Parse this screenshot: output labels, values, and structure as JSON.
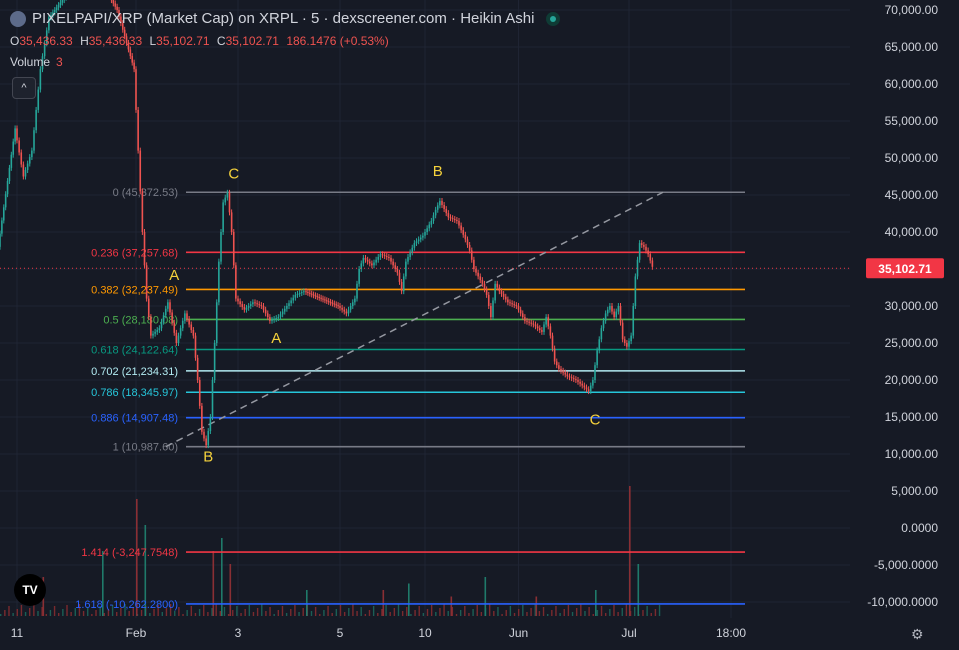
{
  "header": {
    "title": "PIXELPAPI/XRP (Market Cap) on XRPL · 5 · dexscreener.com · Heikin Ashi",
    "ohlc": [
      {
        "k": "O",
        "v": "35,436.33"
      },
      {
        "k": "H",
        "v": "35,436.33"
      },
      {
        "k": "L",
        "v": "35,102.71"
      },
      {
        "k": "C",
        "v": "35,102.71"
      },
      {
        "k": "",
        "v": "186.1476 (+0.53%)"
      }
    ],
    "volume_label": "Volume",
    "volume_value": "3",
    "collapse_icon": "chevron-up-icon",
    "tv_logo_text": "TV",
    "settings_icon": "gear-icon"
  },
  "chart_data": {
    "type": "candlestick",
    "y_axis": {
      "ticks": [
        "70,000.00",
        "65,000.00",
        "60,000.00",
        "55,000.00",
        "50,000.00",
        "45,000.00",
        "40,000.00",
        "35,000.00",
        "30,000.00",
        "25,000.00",
        "20,000.00",
        "15,000.00",
        "10,000.00",
        "5,000.00",
        "0.0000",
        "-5,000.0000",
        "-10,000.0000"
      ],
      "tick_values": [
        70000,
        65000,
        60000,
        55000,
        50000,
        45000,
        40000,
        35000,
        30000,
        25000,
        20000,
        15000,
        10000,
        5000,
        0,
        -5000,
        -10000
      ]
    },
    "x_axis": {
      "ticks": [
        "11",
        "Feb",
        "3",
        "5",
        "10",
        "Jun",
        "Jul",
        "18:00"
      ],
      "tick_positions": [
        0.02,
        0.16,
        0.28,
        0.4,
        0.5,
        0.61,
        0.74,
        0.86
      ]
    },
    "current_price": {
      "label": "35,102.71",
      "value": 35102.71,
      "color": "#f23645"
    },
    "fib_levels": [
      {
        "ratio": "0",
        "value": 45372.53,
        "label": "0 (45,372.53)",
        "color": "#787b86"
      },
      {
        "ratio": "0.236",
        "value": 37257.68,
        "label": "0.236 (37,257.68)",
        "color": "#f23645"
      },
      {
        "ratio": "0.382",
        "value": 32237.49,
        "label": "0.382 (32,237.49)",
        "color": "#ff9800"
      },
      {
        "ratio": "0.5",
        "value": 28180.08,
        "label": "0.5 (28,180.08)",
        "color": "#4caf50"
      },
      {
        "ratio": "0.618",
        "value": 24122.64,
        "label": "0.618 (24,122.64)",
        "color": "#089981"
      },
      {
        "ratio": "0.702",
        "value": 21234.31,
        "label": "0.702 (21,234.31)",
        "color": "#b2ebf2"
      },
      {
        "ratio": "0.786",
        "value": 18345.97,
        "label": "0.786 (18,345.97)",
        "color": "#26c6da"
      },
      {
        "ratio": "0.886",
        "value": 14907.48,
        "label": "0.886 (14,907.48)",
        "color": "#2962ff"
      },
      {
        "ratio": "1",
        "value": 10987.6,
        "label": "1 (10,987.60)",
        "color": "#787b86"
      },
      {
        "ratio": "1.414",
        "value": -3247.7548,
        "label": "1.414 (-3,247.7548)",
        "color": "#f23645"
      },
      {
        "ratio": "1.618",
        "value": -10262.28,
        "label": "1.618 (-10,262.2800)",
        "color": "#2962ff"
      }
    ],
    "wave_labels": [
      {
        "text": "C",
        "x": 0.275,
        "value": 47200
      },
      {
        "text": "B",
        "x": 0.245,
        "value": 9000
      },
      {
        "text": "A",
        "x": 0.205,
        "value": 33500
      },
      {
        "text": "A",
        "x": 0.325,
        "value": 25000
      },
      {
        "text": "B",
        "x": 0.515,
        "value": 47600
      },
      {
        "text": "C",
        "x": 0.7,
        "value": 14000
      }
    ],
    "price_path": [
      [
        0.0,
        38000
      ],
      [
        0.02,
        54000
      ],
      [
        0.03,
        47500
      ],
      [
        0.04,
        51000
      ],
      [
        0.05,
        62000
      ],
      [
        0.06,
        69000
      ],
      [
        0.08,
        72000
      ],
      [
        0.1,
        73000
      ],
      [
        0.12,
        74000
      ],
      [
        0.14,
        70000
      ],
      [
        0.16,
        62000
      ],
      [
        0.17,
        40000
      ],
      [
        0.175,
        31000
      ],
      [
        0.18,
        26000
      ],
      [
        0.19,
        27000
      ],
      [
        0.2,
        30500
      ],
      [
        0.21,
        25000
      ],
      [
        0.22,
        29000
      ],
      [
        0.23,
        26000
      ],
      [
        0.235,
        20000
      ],
      [
        0.24,
        13000
      ],
      [
        0.245,
        11200
      ],
      [
        0.25,
        15000
      ],
      [
        0.255,
        25000
      ],
      [
        0.26,
        36000
      ],
      [
        0.265,
        44000
      ],
      [
        0.27,
        45300
      ],
      [
        0.275,
        40000
      ],
      [
        0.28,
        31000
      ],
      [
        0.29,
        29500
      ],
      [
        0.3,
        30500
      ],
      [
        0.31,
        30000
      ],
      [
        0.32,
        28000
      ],
      [
        0.33,
        28500
      ],
      [
        0.34,
        30000
      ],
      [
        0.35,
        31500
      ],
      [
        0.36,
        32000
      ],
      [
        0.38,
        31000
      ],
      [
        0.4,
        30000
      ],
      [
        0.41,
        29000
      ],
      [
        0.42,
        31000
      ],
      [
        0.425,
        35000
      ],
      [
        0.43,
        36500
      ],
      [
        0.44,
        35500
      ],
      [
        0.45,
        37000
      ],
      [
        0.46,
        36500
      ],
      [
        0.47,
        34500
      ],
      [
        0.475,
        32000
      ],
      [
        0.48,
        36000
      ],
      [
        0.49,
        38500
      ],
      [
        0.5,
        39500
      ],
      [
        0.51,
        41500
      ],
      [
        0.515,
        43000
      ],
      [
        0.52,
        44200
      ],
      [
        0.53,
        42000
      ],
      [
        0.54,
        41500
      ],
      [
        0.55,
        39000
      ],
      [
        0.555,
        37500
      ],
      [
        0.56,
        35000
      ],
      [
        0.57,
        33000
      ],
      [
        0.575,
        31500
      ],
      [
        0.58,
        28500
      ],
      [
        0.585,
        33000
      ],
      [
        0.59,
        32000
      ],
      [
        0.6,
        30500
      ],
      [
        0.61,
        30000
      ],
      [
        0.62,
        28000
      ],
      [
        0.63,
        27500
      ],
      [
        0.64,
        26500
      ],
      [
        0.645,
        28500
      ],
      [
        0.65,
        26000
      ],
      [
        0.655,
        22500
      ],
      [
        0.66,
        21500
      ],
      [
        0.67,
        20500
      ],
      [
        0.68,
        20000
      ],
      [
        0.69,
        19000
      ],
      [
        0.695,
        18500
      ],
      [
        0.7,
        20000
      ],
      [
        0.705,
        24000
      ],
      [
        0.71,
        27000
      ],
      [
        0.715,
        29000
      ],
      [
        0.72,
        30000
      ],
      [
        0.725,
        28500
      ],
      [
        0.73,
        30000
      ],
      [
        0.735,
        25500
      ],
      [
        0.74,
        24500
      ],
      [
        0.745,
        26000
      ],
      [
        0.75,
        34000
      ],
      [
        0.755,
        38500
      ],
      [
        0.76,
        38000
      ],
      [
        0.765,
        37000
      ],
      [
        0.77,
        35300
      ]
    ],
    "volume_spikes": [
      {
        "x": 0.05,
        "value": 0.3
      },
      {
        "x": 0.12,
        "value": 0.5
      },
      {
        "x": 0.16,
        "value": 0.9
      },
      {
        "x": 0.17,
        "value": 0.7
      },
      {
        "x": 0.25,
        "value": 0.5
      },
      {
        "x": 0.26,
        "value": 0.6
      },
      {
        "x": 0.27,
        "value": 0.4
      },
      {
        "x": 0.36,
        "value": 0.2
      },
      {
        "x": 0.45,
        "value": 0.2
      },
      {
        "x": 0.48,
        "value": 0.25
      },
      {
        "x": 0.53,
        "value": 0.15
      },
      {
        "x": 0.57,
        "value": 0.3
      },
      {
        "x": 0.63,
        "value": 0.15
      },
      {
        "x": 0.7,
        "value": 0.2
      },
      {
        "x": 0.74,
        "value": 1.0
      },
      {
        "x": 0.75,
        "value": 0.4
      }
    ],
    "trendline": {
      "from": [
        0.195,
        10987.6
      ],
      "to": [
        0.78,
        45372.53
      ],
      "style": "dashed",
      "color": "#9598a1"
    }
  }
}
